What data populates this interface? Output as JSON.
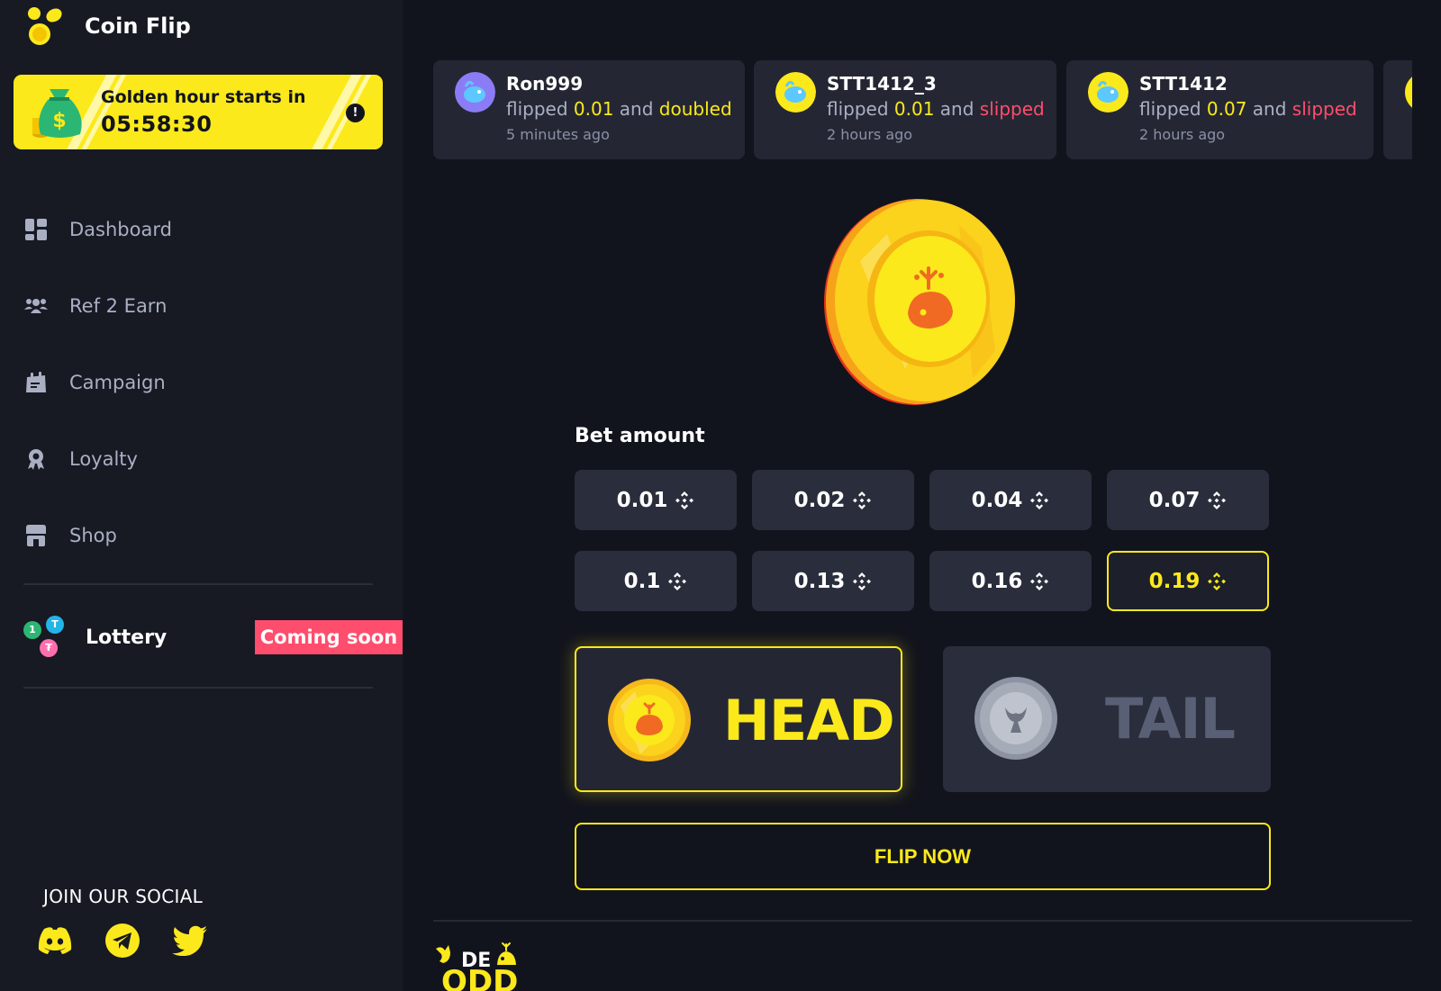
{
  "app": {
    "title": "Coin Flip"
  },
  "golden_hour": {
    "label": "Golden hour starts in",
    "countdown": "05:58:30",
    "info": "!"
  },
  "nav": {
    "items": [
      {
        "label": "Dashboard",
        "icon": "dashboard-icon"
      },
      {
        "label": "Ref 2 Earn",
        "icon": "referral-icon"
      },
      {
        "label": "Campaign",
        "icon": "campaign-icon"
      },
      {
        "label": "Loyalty",
        "icon": "loyalty-icon"
      },
      {
        "label": "Shop",
        "icon": "shop-icon"
      }
    ]
  },
  "lottery": {
    "label": "Lottery",
    "badge": "Coming soon",
    "balls": [
      "1",
      "T",
      "₮"
    ]
  },
  "social": {
    "title": "JOIN OUR SOCIAL",
    "links": [
      "discord-icon",
      "telegram-icon",
      "twitter-icon"
    ]
  },
  "feed": [
    {
      "user": "Ron999",
      "verb": "flipped",
      "amount": "0.01",
      "conj": "and",
      "result": "doubled",
      "result_type": "win",
      "time": "5 minutes ago"
    },
    {
      "user": "STT1412_3",
      "verb": "flipped",
      "amount": "0.01",
      "conj": "and",
      "result": "slipped",
      "result_type": "loss",
      "time": "2 hours ago"
    },
    {
      "user": "STT1412",
      "verb": "flipped",
      "amount": "0.07",
      "conj": "and",
      "result": "slipped",
      "result_type": "loss",
      "time": "2 hours ago"
    }
  ],
  "bet": {
    "label": "Bet amount",
    "amounts": [
      "0.01",
      "0.02",
      "0.04",
      "0.07",
      "0.1",
      "0.13",
      "0.16",
      "0.19"
    ],
    "selected": "0.19"
  },
  "sides": {
    "head": "HEAD",
    "tail": "TAIL",
    "selected": "HEAD"
  },
  "flip_button": "FLIP NOW",
  "footer": {
    "logo_top": "DE",
    "logo_bottom": "ODD"
  },
  "colors": {
    "accent": "#fbe91b",
    "loss": "#ff4d6d",
    "bg": "#12141d",
    "panel": "#2a2d3b"
  }
}
